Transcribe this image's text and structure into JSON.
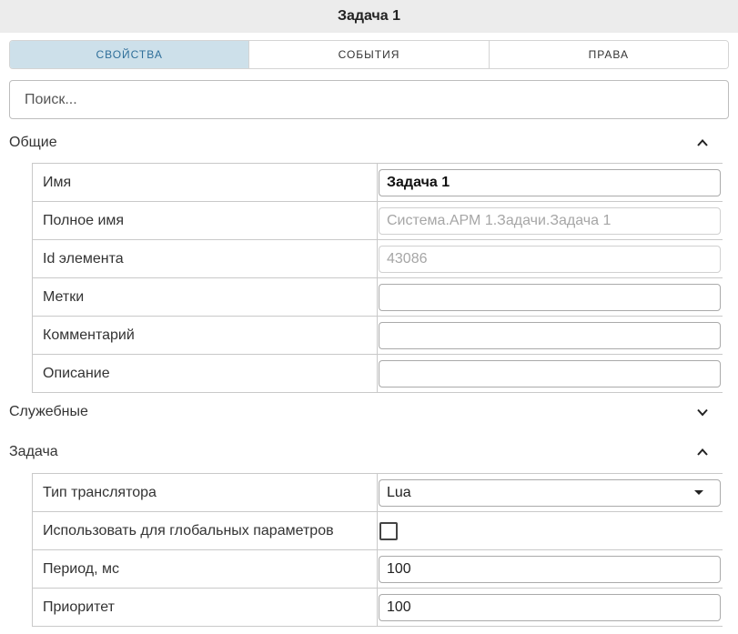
{
  "window": {
    "title": "Задача 1"
  },
  "tabs": [
    {
      "label": "СВОЙСТВА",
      "active": true
    },
    {
      "label": "СОБЫТИЯ",
      "active": false
    },
    {
      "label": "ПРАВА",
      "active": false
    }
  ],
  "search": {
    "placeholder": "Поиск..."
  },
  "sections": {
    "general": {
      "title": "Общие",
      "expanded": true,
      "chevron_icon": "chevron-up-icon",
      "rows": {
        "name": {
          "label": "Имя",
          "value": "Задача 1"
        },
        "full_name": {
          "label": "Полное имя",
          "value": "Система.АРМ 1.Задачи.Задача 1"
        },
        "element_id": {
          "label": "Id элемента",
          "value": "43086"
        },
        "tags": {
          "label": "Метки",
          "value": ""
        },
        "comment": {
          "label": "Комментарий",
          "value": ""
        },
        "description": {
          "label": "Описание",
          "value": ""
        }
      }
    },
    "service": {
      "title": "Служебные",
      "expanded": false,
      "chevron_icon": "chevron-down-icon"
    },
    "task": {
      "title": "Задача",
      "expanded": true,
      "chevron_icon": "chevron-up-icon",
      "rows": {
        "translator_type": {
          "label": "Тип транслятора",
          "value": "Lua"
        },
        "use_for_global": {
          "label": "Использовать для глобальных параметров",
          "checked": false
        },
        "period": {
          "label": "Период, мс",
          "value": "100"
        },
        "priority": {
          "label": "Приоритет",
          "value": "100"
        }
      }
    }
  },
  "colors": {
    "active_tab_bg": "#cde0ea",
    "active_tab_text": "#2f6f9a",
    "title_bar_bg": "#ececec"
  }
}
